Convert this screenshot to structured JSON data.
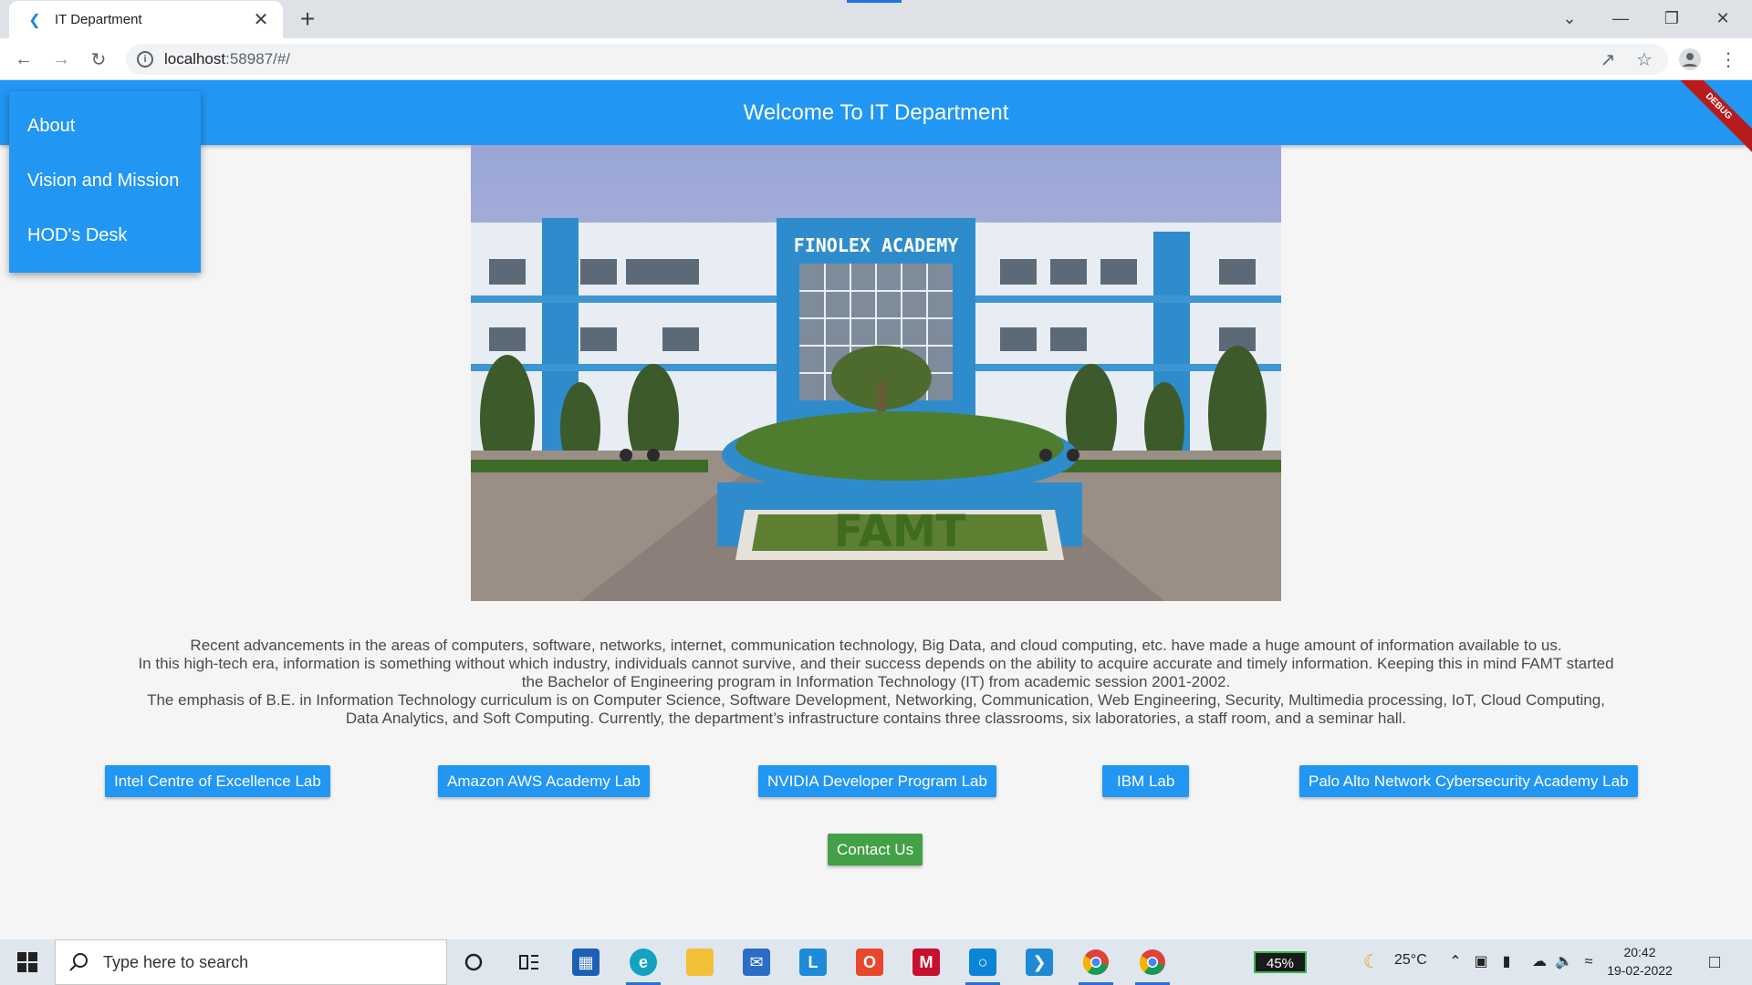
{
  "browser": {
    "tab_title": "IT Department",
    "url_host": "localhost",
    "url_path": ":58987/#/"
  },
  "app": {
    "title": "Welcome To IT Department",
    "debug_label": "DEBUG",
    "accent": "#2196f3",
    "menu": [
      {
        "label": "About"
      },
      {
        "label": "Vision and Mission"
      },
      {
        "label": "HOD's Desk"
      }
    ],
    "hero_sign": "FINOLEX ACADEMY",
    "hero_hedge": "FAMT",
    "description": [
      "Recent advancements in the areas of computers, software, networks, internet, communication technology, Big Data, and cloud computing, etc. have made a huge amount of information available to us.",
      "In this high-tech era, information is something without which industry, individuals cannot survive, and their success depends on the ability to acquire accurate and timely information. Keeping this in mind FAMT started",
      "the Bachelor of Engineering program in Information Technology (IT) from academic session 2001-2002.",
      "The emphasis of B.E. in Information Technology curriculum is on Computer Science, Software Development, Networking, Communication, Web Engineering, Security, Multimedia processing, IoT, Cloud Computing,",
      "Data Analytics, and Soft Computing. Currently, the department’s infrastructure contains three classrooms, six laboratories, a staff room, and a seminar hall."
    ],
    "labs": [
      {
        "label": "Intel Centre of Excellence Lab"
      },
      {
        "label": "Amazon AWS Academy Lab"
      },
      {
        "label": "NVIDIA Developer Program Lab"
      },
      {
        "label": "IBM Lab"
      },
      {
        "label": "Palo Alto Network Cybersecurity Academy Lab"
      }
    ],
    "contact_label": "Contact Us",
    "contact_color": "#43a047"
  },
  "taskbar": {
    "search_placeholder": "Type here to search",
    "battery": "45%",
    "temperature": "25°C",
    "time": "20:42",
    "date": "19-02-2022"
  }
}
